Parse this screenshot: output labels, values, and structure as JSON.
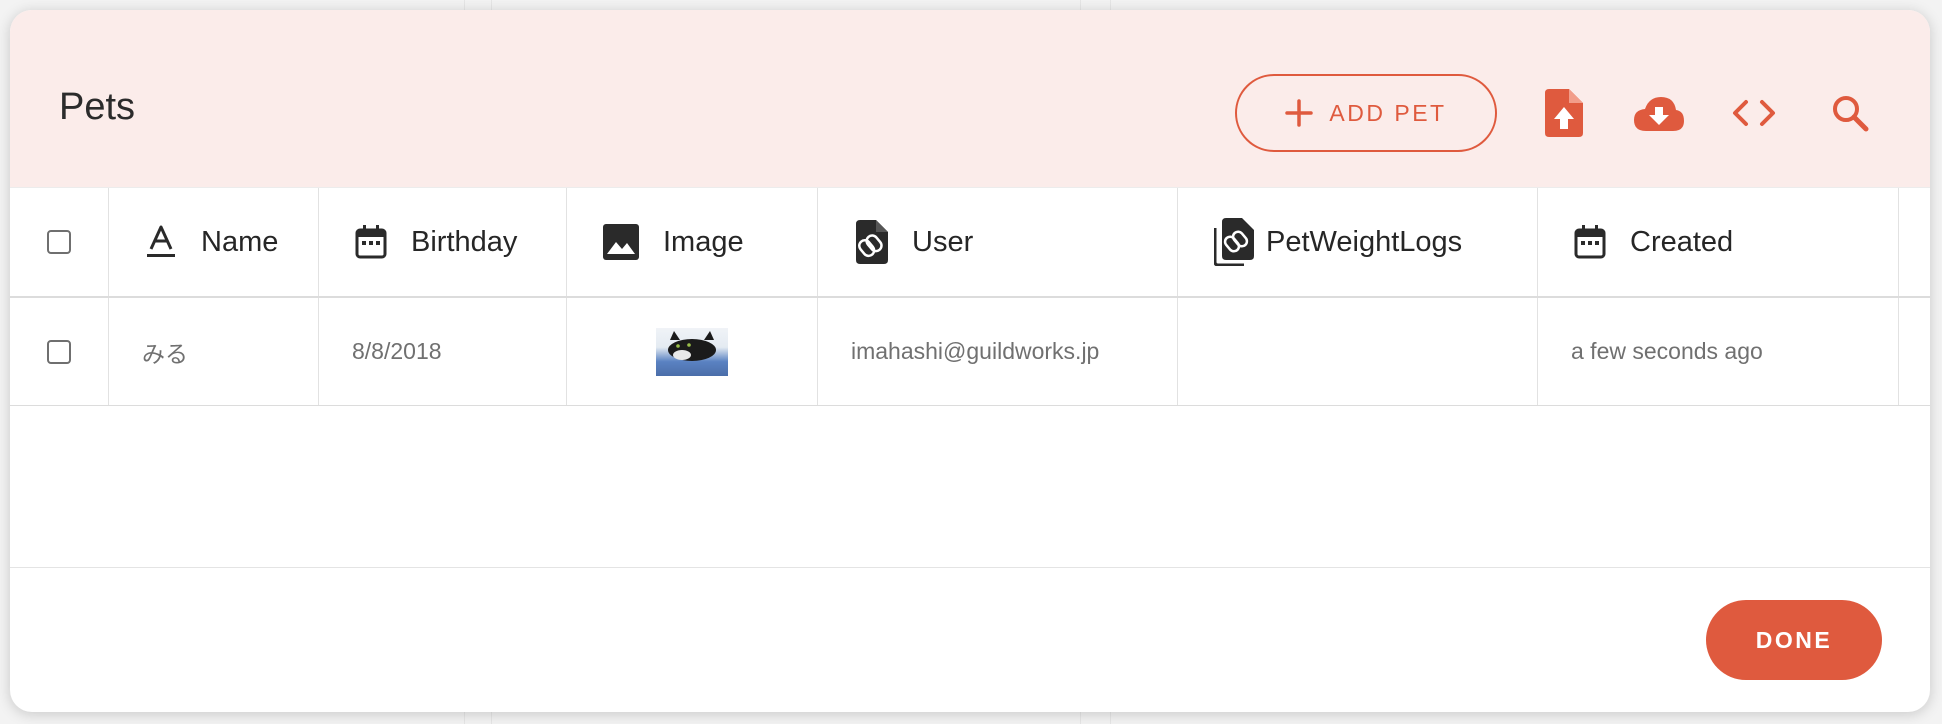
{
  "dialog": {
    "title": "Pets",
    "toolbar": {
      "add_label": "ADD PET",
      "icons": [
        "plus-icon",
        "file-upload-icon",
        "cloud-download-icon",
        "code-icon",
        "search-icon"
      ]
    },
    "table": {
      "columns": [
        {
          "label": "Name",
          "icon": "text-format-icon"
        },
        {
          "label": "Birthday",
          "icon": "calendar-icon"
        },
        {
          "label": "Image",
          "icon": "image-icon"
        },
        {
          "label": "User",
          "icon": "linked-document-icon"
        },
        {
          "label": "PetWeightLogs",
          "icon": "linked-documents-icon"
        },
        {
          "label": "Created",
          "icon": "calendar-icon"
        }
      ],
      "rows": [
        {
          "name": "みる",
          "birthday": "8/8/2018",
          "image": "cat-photo-thumbnail",
          "user": "imahashi@guildworks.jp",
          "pet_weight_logs": "",
          "created": "a few seconds ago"
        }
      ]
    },
    "done_label": "DONE",
    "colors": {
      "accent": "#df5a3e",
      "header_background": "#fbecea",
      "text_primary": "#262626",
      "text_secondary": "#707070"
    }
  }
}
